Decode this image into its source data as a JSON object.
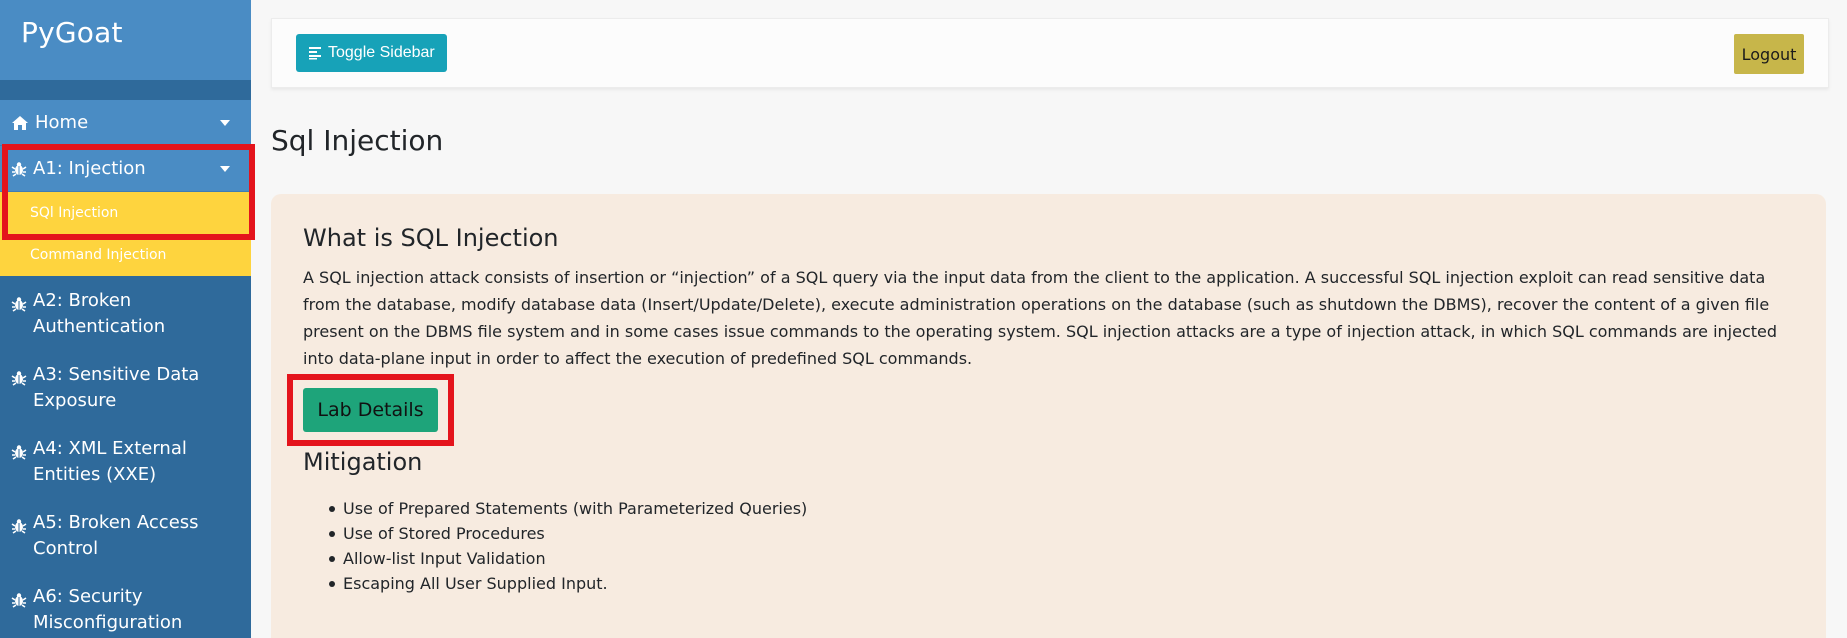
{
  "app": {
    "brand": "PyGoat"
  },
  "sidebar": {
    "items": [
      {
        "label": "Home",
        "icon": "home-icon",
        "expandable": true
      },
      {
        "label": "A1: Injection",
        "icon": "bug-icon",
        "expandable": true,
        "children": [
          "SQl Injection",
          "Command Injection"
        ]
      },
      {
        "label": "A2: Broken Authentication",
        "icon": "bug-icon"
      },
      {
        "label": "A3: Sensitive Data Exposure",
        "icon": "bug-icon"
      },
      {
        "label": "A4: XML External Entities (XXE)",
        "icon": "bug-icon"
      },
      {
        "label": "A5: Broken Access Control",
        "icon": "bug-icon"
      },
      {
        "label": "A6: Security Misconfiguration",
        "icon": "bug-icon"
      }
    ]
  },
  "topbar": {
    "toggle_label": "Toggle Sidebar",
    "logout_label": "Logout"
  },
  "main": {
    "page_title": "Sql Injection",
    "card": {
      "title": "What is SQL Injection",
      "body": "A SQL injection attack consists of insertion or “injection” of a SQL query via the input data from the client to the application. A successful SQL injection exploit can read sensitive data from the database, modify database data (Insert/Update/Delete), execute administration operations on the database (such as shutdown the DBMS), recover the content of a given file present on the DBMS file system and in some cases issue commands to the operating system. SQL injection attacks are a type of injection attack, in which SQL commands are injected into data-plane input in order to affect the execution of predefined SQL commands.",
      "lab_button": "Lab Details",
      "mitigation_title": "Mitigation",
      "mitigations": [
        "Use of Prepared Statements (with Parameterized Queries)",
        "Use of Stored Procedures",
        "Allow-list Input Validation",
        "Escaping All User Supplied Input."
      ]
    }
  },
  "colors": {
    "sidebar_bg": "#2f6a9b",
    "sidebar_header": "#4a8cc4",
    "submenu_bg": "#fed43e",
    "toggle_btn": "#17a2b8",
    "logout_btn": "#c7b64a",
    "lab_btn": "#1ea47a",
    "card_bg": "#f7ebe0",
    "highlight": "#e4141c"
  }
}
